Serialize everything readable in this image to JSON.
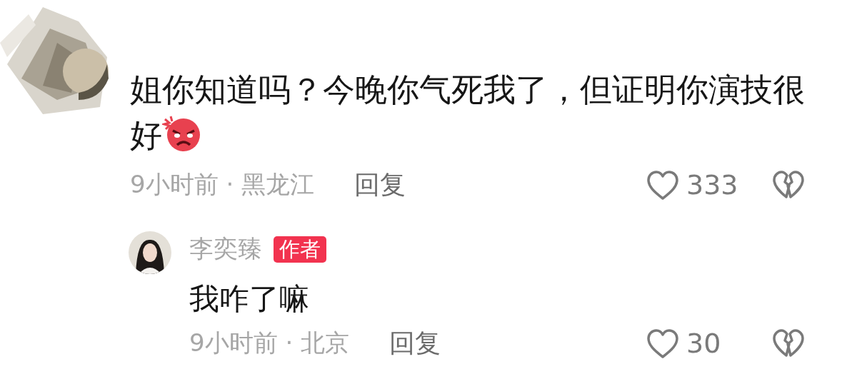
{
  "comment": {
    "text": "姐你知道吗？今晚你气死我了，但证明你演技很好",
    "meta": "9小时前 · 黑龙江",
    "reply_label": "回复",
    "likes": "333"
  },
  "reply": {
    "author": "李奕臻",
    "badge": "作者",
    "text": "我咋了嘛",
    "meta": "9小时前 · 北京",
    "reply_label": "回复",
    "likes": "30"
  }
}
